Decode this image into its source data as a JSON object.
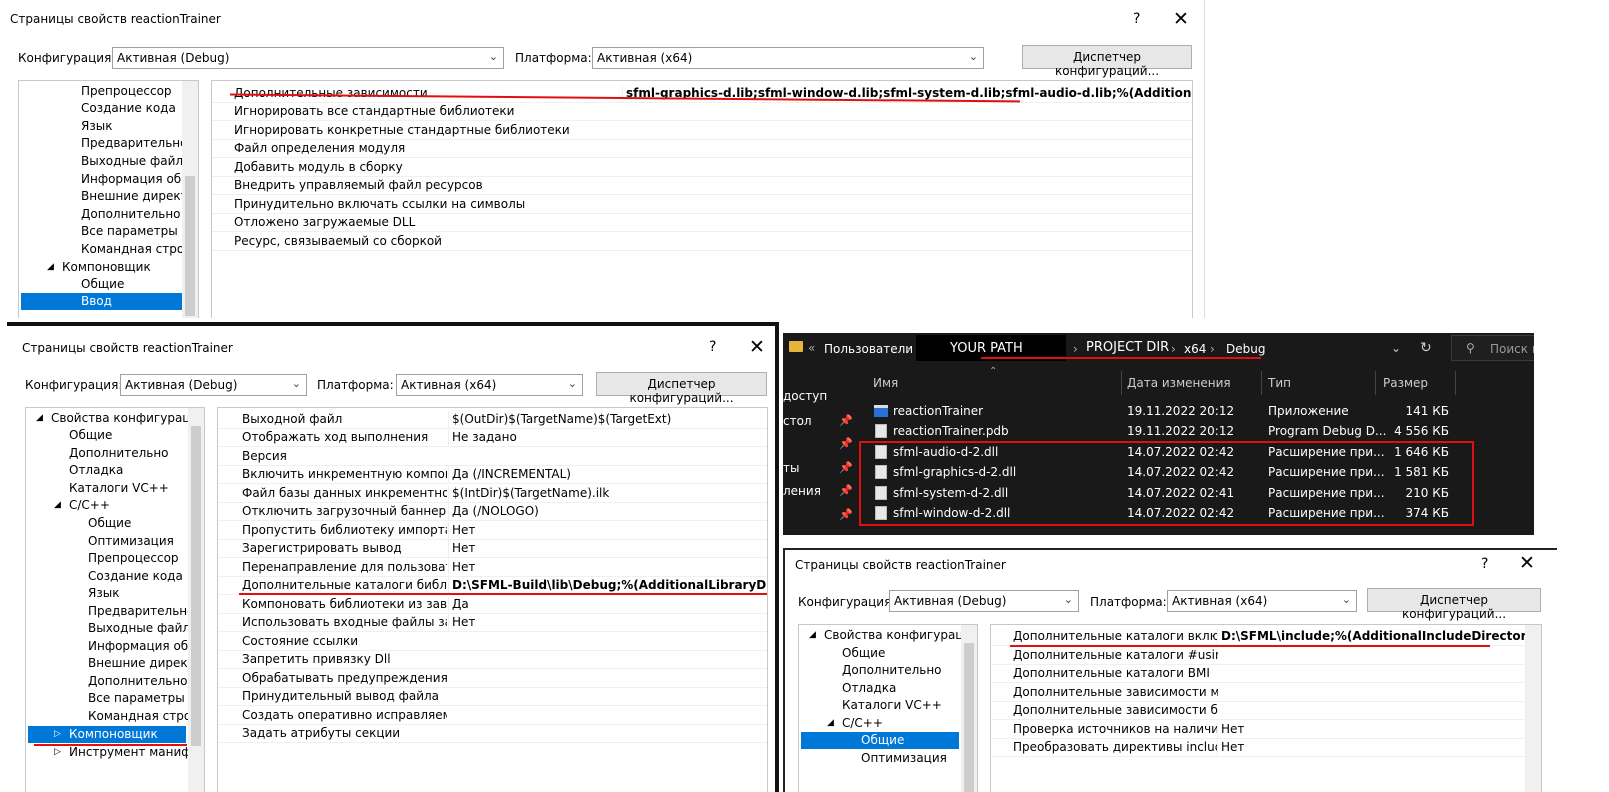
{
  "dlg1": {
    "title": "Страницы свойств reactionTrainer",
    "help": "?",
    "close": "✕",
    "cfg_label": "Конфигурация:",
    "cfg_value": "Активная (Debug)",
    "plat_label": "Платформа:",
    "plat_value": "Активная (x64)",
    "mgr_button": "Диспетчер конфигураций...",
    "tree": [
      "Препроцессор",
      "Создание кода",
      "Язык",
      "Предварительно от",
      "Выходные файлы",
      "Информация об ис",
      "Внешние директив",
      "Дополнительно",
      "Все параметры",
      "Командная строка",
      "Компоновщик",
      "Общие",
      "Ввод"
    ],
    "props": [
      "Дополнительные зависимости",
      "Игнорировать все стандартные библиотеки",
      "Игнорировать конкретные стандартные библиотеки",
      "Файл определения модуля",
      "Добавить модуль в сборку",
      "Внедрить управляемый файл ресурсов",
      "Принудительно включать ссылки на символы",
      "Отложено загружаемые DLL",
      "Ресурс, связываемый со сборкой"
    ],
    "value0": "sfml-graphics-d.lib;sfml-window-d.lib;sfml-system-d.lib;sfml-audio-d.lib;%(AdditionalDependencies)"
  },
  "dlg2": {
    "title": "Страницы свойств reactionTrainer",
    "help": "?",
    "close": "✕",
    "cfg_label": "Конфигурация:",
    "cfg_value": "Активная (Debug)",
    "plat_label": "Платформа:",
    "plat_value": "Активная (x64)",
    "mgr_button": "Диспетчер конфигураций...",
    "tree": [
      "Свойства конфигурации",
      "Общие",
      "Дополнительно",
      "Отладка",
      "Каталоги VC++",
      "C/C++",
      "Общие",
      "Оптимизация",
      "Препроцессор",
      "Создание кода",
      "Язык",
      "Предварительно от",
      "Выходные файлы",
      "Информация об ис",
      "Внешние директив",
      "Дополнительно",
      "Все параметры",
      "Командная строка",
      "Компоновщик",
      "Инструмент манифест"
    ],
    "props": [
      {
        "n": "Выходной файл",
        "v": "$(OutDir)$(TargetName)$(TargetExt)"
      },
      {
        "n": "Отображать ход выполнения",
        "v": "Не задано"
      },
      {
        "n": "Версия",
        "v": ""
      },
      {
        "n": "Включить инкрементную компоновку",
        "v": "Да (/INCREMENTAL)"
      },
      {
        "n": "Файл базы данных инкрементной компоновки",
        "v": "$(IntDir)$(TargetName).ilk"
      },
      {
        "n": "Отключить загрузочный баннер",
        "v": "Да (/NOLOGO)"
      },
      {
        "n": "Пропустить библиотеку импорта",
        "v": "Нет"
      },
      {
        "n": "Зарегистрировать вывод",
        "v": "Нет"
      },
      {
        "n": "Перенаправление для пользователей",
        "v": "Нет"
      },
      {
        "n": "Дополнительные каталоги библиотек",
        "v": "D:\\SFML-Build\\lib\\Debug;%(AdditionalLibraryDirectories)"
      },
      {
        "n": "Компоновать библиотеки из зависимостей",
        "v": "Да"
      },
      {
        "n": "Использовать входные файлы зависимостей",
        "v": "Нет"
      },
      {
        "n": "Состояние ссылки",
        "v": ""
      },
      {
        "n": "Запретить привязку Dll",
        "v": ""
      },
      {
        "n": "Обрабатывать предупреждения компоновщика",
        "v": ""
      },
      {
        "n": "Принудительный вывод файла",
        "v": ""
      },
      {
        "n": "Создать оперативно исправляемый образ",
        "v": ""
      },
      {
        "n": "Задать атрибуты секции",
        "v": ""
      }
    ]
  },
  "explorer": {
    "breadcrumb": [
      "Пользователи",
      "YOUR PATH",
      "PROJECT DIR",
      "x64",
      "Debug"
    ],
    "chevrons": "«",
    "search_placeholder": "Поиск в",
    "nav": [
      "доступ",
      "стол",
      "ты",
      "ления"
    ],
    "headers": [
      "Имя",
      "Дата изменения",
      "Тип",
      "Размер"
    ],
    "files": [
      {
        "name": "reactionTrainer",
        "date": "19.11.2022 20:12",
        "type": "Приложение",
        "size": "141 КБ"
      },
      {
        "name": "reactionTrainer.pdb",
        "date": "19.11.2022 20:12",
        "type": "Program Debug D...",
        "size": "4 556 КБ"
      },
      {
        "name": "sfml-audio-d-2.dll",
        "date": "14.07.2022 02:42",
        "type": "Расширение при...",
        "size": "1 646 КБ"
      },
      {
        "name": "sfml-graphics-d-2.dll",
        "date": "14.07.2022 02:42",
        "type": "Расширение при...",
        "size": "1 581 КБ"
      },
      {
        "name": "sfml-system-d-2.dll",
        "date": "14.07.2022 02:41",
        "type": "Расширение при...",
        "size": "210 КБ"
      },
      {
        "name": "sfml-window-d-2.dll",
        "date": "14.07.2022 02:42",
        "type": "Расширение при...",
        "size": "374 КБ"
      }
    ]
  },
  "dlg3": {
    "title": "Страницы свойств reactionTrainer",
    "help": "?",
    "close": "✕",
    "cfg_label": "Конфигурация:",
    "cfg_value": "Активная (Debug)",
    "plat_label": "Платформа:",
    "plat_value": "Активная (x64)",
    "mgr_button": "Диспетчер конфигураций...",
    "tree": [
      "Свойства конфигурации",
      "Общие",
      "Дополнительно",
      "Отладка",
      "Каталоги VC++",
      "C/C++",
      "Общие",
      "Оптимизация"
    ],
    "props": [
      {
        "n": "Дополнительные каталоги включаемых файлов",
        "v": "D:\\SFML\\include;%(AdditionalIncludeDirectories)"
      },
      {
        "n": "Дополнительные каталоги #using",
        "v": ""
      },
      {
        "n": "Дополнительные каталоги BMI",
        "v": ""
      },
      {
        "n": "Дополнительные зависимости модулей",
        "v": ""
      },
      {
        "n": "Дополнительные зависимости блоков",
        "v": ""
      },
      {
        "n": "Проверка источников на наличие зависимостей",
        "v": "Нет"
      },
      {
        "n": "Преобразовать директивы include в директивы import",
        "v": "Нет"
      }
    ]
  }
}
